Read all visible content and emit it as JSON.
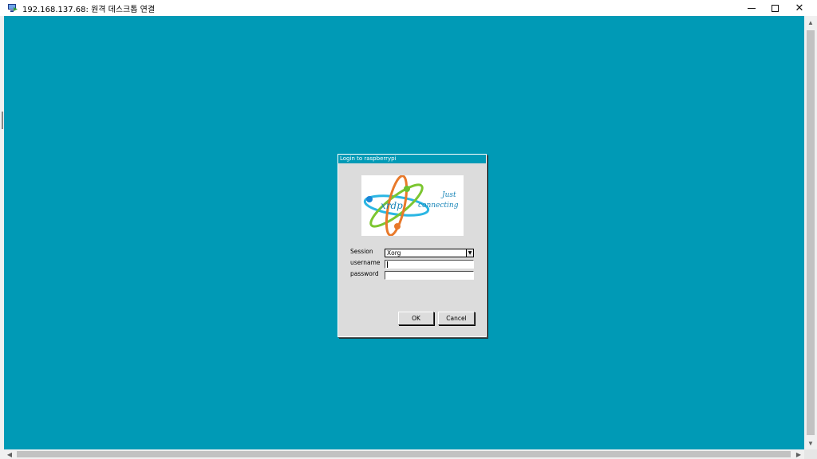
{
  "window": {
    "title": "192.168.137.68: 원격 데스크톱 연결",
    "minimize_glyph": "",
    "close_glyph": "✕"
  },
  "dialog": {
    "title": "Login to raspberrypi",
    "logo": {
      "brand": "xrdp",
      "tagline_line1": "Just",
      "tagline_line2": "connecting"
    },
    "fields": {
      "session_label": "Session",
      "session_value": "Xorg",
      "username_label": "username",
      "username_value": "",
      "password_label": "password",
      "password_value": ""
    },
    "buttons": {
      "ok": "OK",
      "cancel": "Cancel"
    }
  },
  "colors": {
    "desktop_background": "#009ab6",
    "dialog_background": "#dcdcdc",
    "dialog_title_bar": "#009ab6"
  },
  "icons": {
    "app_icon": "remote-desktop-icon",
    "session_dropdown": "dropdown-arrow-icon"
  }
}
